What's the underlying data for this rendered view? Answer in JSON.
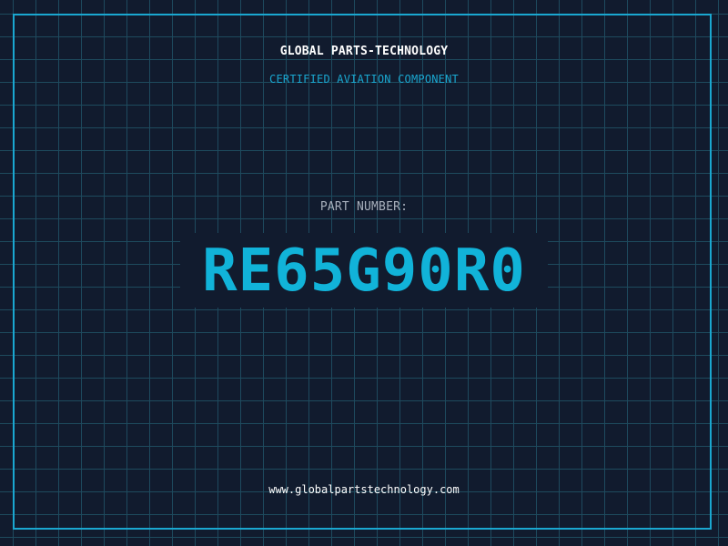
{
  "header": {
    "company_name": "GLOBAL PARTS-TECHNOLOGY",
    "subtitle": "CERTIFIED AVIATION COMPONENT"
  },
  "part": {
    "label": "PART NUMBER:",
    "number": "RE65G90R0"
  },
  "footer": {
    "url": "www.globalpartstechnology.com"
  },
  "colors": {
    "background": "#111b2e",
    "grid": "#1e4a5e",
    "accent": "#11b3d9",
    "text": "#ffffff"
  }
}
